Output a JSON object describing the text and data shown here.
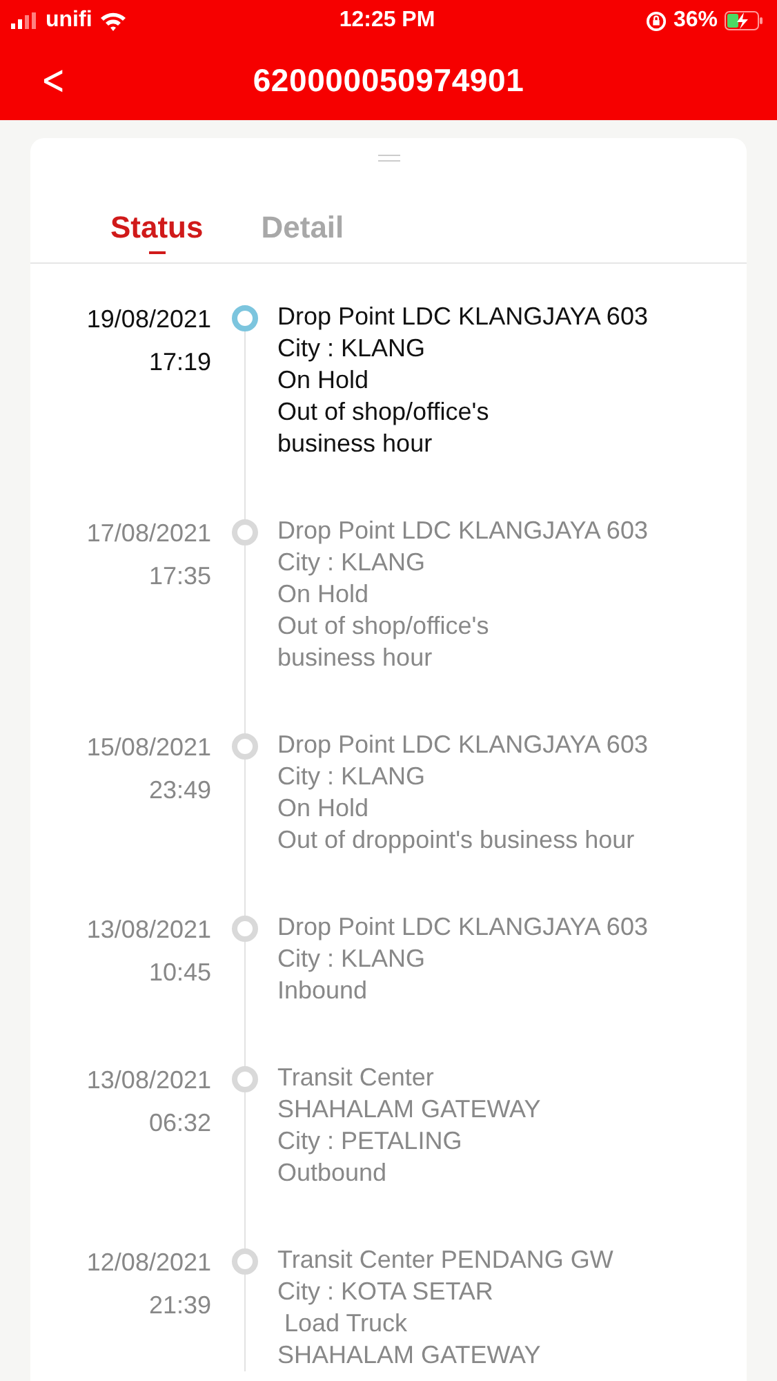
{
  "status_bar": {
    "carrier": "unifi",
    "time": "12:25 PM",
    "battery": "36%"
  },
  "header": {
    "back": "<",
    "title": "620000050974901"
  },
  "tabs": [
    {
      "label": "Status",
      "selected": true
    },
    {
      "label": "Detail",
      "selected": false
    }
  ],
  "events": [
    {
      "date": "19/08/2021",
      "time": "17:19",
      "current": true,
      "lines": [
        "Drop Point LDC KLANGJAYA 603",
        "City : KLANG",
        "On Hold",
        "Out of shop/office's",
        "business hour"
      ]
    },
    {
      "date": "17/08/2021",
      "time": "17:35",
      "current": false,
      "lines": [
        "Drop Point LDC KLANGJAYA 603",
        "City : KLANG",
        "On Hold",
        "Out of shop/office's",
        "business hour"
      ]
    },
    {
      "date": "15/08/2021",
      "time": "23:49",
      "current": false,
      "lines": [
        "Drop Point LDC KLANGJAYA 603",
        "City : KLANG",
        "On Hold",
        "Out of droppoint's business hour"
      ]
    },
    {
      "date": "13/08/2021",
      "time": "10:45",
      "current": false,
      "lines": [
        "Drop Point LDC KLANGJAYA 603",
        "City : KLANG",
        "Inbound"
      ]
    },
    {
      "date": "13/08/2021",
      "time": "06:32",
      "current": false,
      "lines": [
        "Transit Center",
        "SHAHALAM GATEWAY",
        "City : PETALING",
        "Outbound"
      ]
    },
    {
      "date": "12/08/2021",
      "time": "21:39",
      "current": false,
      "lines": [
        "Transit Center PENDANG GW",
        "City : KOTA SETAR",
        " Load Truck",
        "SHAHALAM GATEWAY"
      ]
    }
  ]
}
